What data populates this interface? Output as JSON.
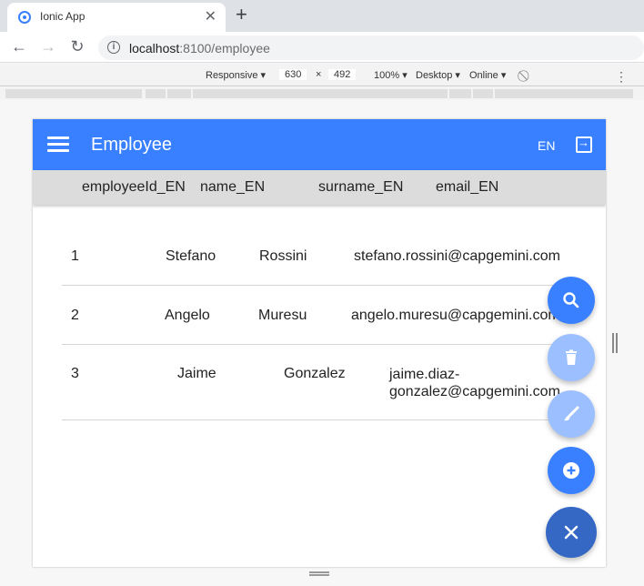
{
  "browser": {
    "tab_title": "Ionic App",
    "url_host": "localhost",
    "url_path": ":8100/employee"
  },
  "devtools": {
    "device": "Responsive ▾",
    "width": "630",
    "times": "×",
    "height": "492",
    "zoom": "100% ▾",
    "mode": "Desktop ▾",
    "network": "Online ▾"
  },
  "app": {
    "title": "Employee",
    "lang": "EN",
    "columns": [
      "employeeId_EN",
      "name_EN",
      "surname_EN",
      "email_EN"
    ],
    "rows": [
      {
        "id": "1",
        "name": "Stefano",
        "surname": "Rossini",
        "email": "stefano.rossini@capgemini.com"
      },
      {
        "id": "2",
        "name": "Angelo",
        "surname": "Muresu",
        "email": "angelo.muresu@capgemini.com"
      },
      {
        "id": "3",
        "name": "Jaime",
        "surname": "Gonzalez",
        "email": "jaime.diaz-gonzalez@capgemini.com"
      }
    ],
    "email_row3_line1": "jaime.diaz-",
    "email_row3_line2": "gonzalez@capgemini.com"
  },
  "colors": {
    "primary": "#3880ff",
    "primary_light": "#9cc0ff",
    "primary_dark": "#3468c4"
  },
  "icons": [
    "search-icon",
    "trash-icon",
    "brush-icon",
    "add-circle-icon",
    "close-icon",
    "menu-icon",
    "logout-icon"
  ]
}
